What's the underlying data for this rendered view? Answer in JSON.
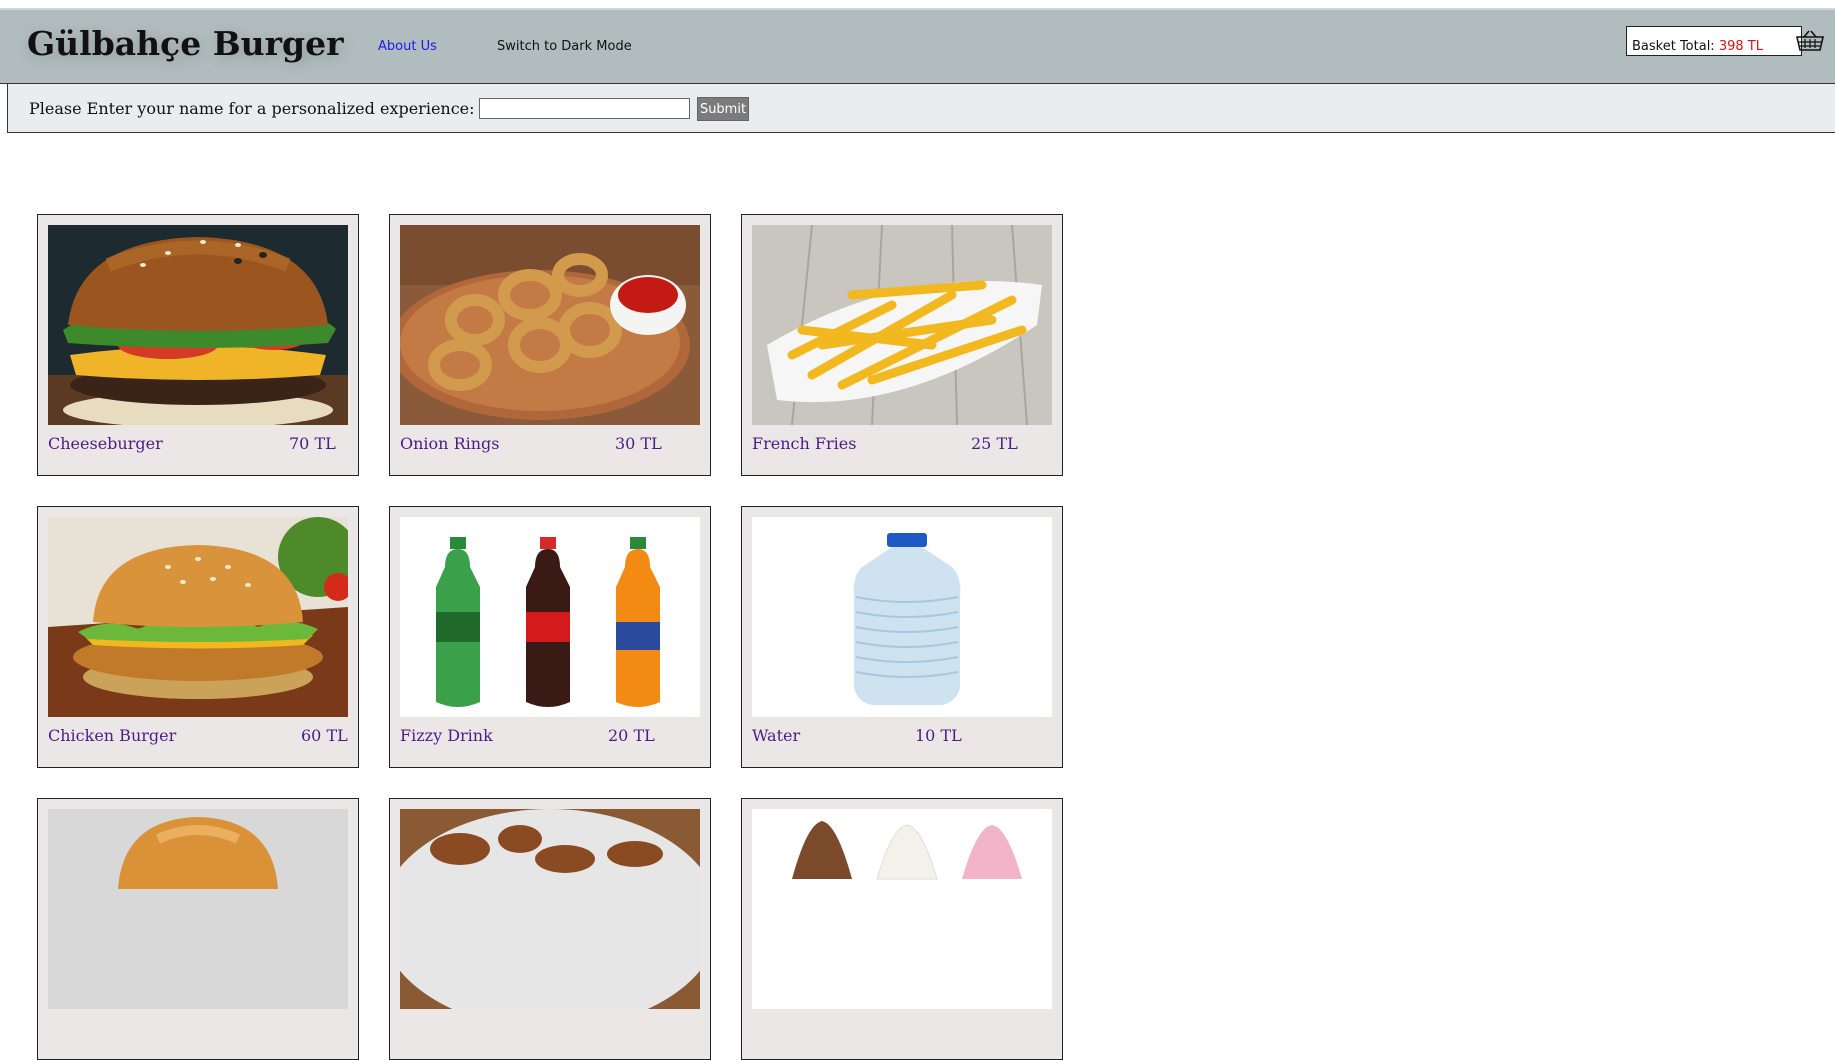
{
  "header": {
    "title": "Gülbahçe Burger",
    "about_label": "About Us",
    "dark_mode_label": "Switch to Dark Mode",
    "basket_label": "Basket Total:",
    "basket_total": "398 TL",
    "basket_icon": "basket-icon"
  },
  "name_prompt": {
    "label": "Please Enter your name for a personalized experience:",
    "input_value": "",
    "submit_label": "Submit"
  },
  "menu": [
    {
      "name": "Cheeseburger",
      "price": "70 TL",
      "image": "cheeseburger-image"
    },
    {
      "name": "Onion Rings",
      "price": "30 TL",
      "image": "onion-rings-image"
    },
    {
      "name": "French Fries",
      "price": "25 TL",
      "image": "french-fries-image"
    },
    {
      "name": "Chicken Burger",
      "price": "60 TL",
      "image": "chicken-burger-image"
    },
    {
      "name": "Fizzy Drink",
      "price": "20 TL",
      "image": "fizzy-drink-image"
    },
    {
      "name": "Water",
      "price": "10 TL",
      "image": "water-bottle-image"
    },
    {
      "name": "",
      "price": "",
      "image": "bun-burger-image"
    },
    {
      "name": "",
      "price": "",
      "image": "chicken-wings-image"
    },
    {
      "name": "",
      "price": "",
      "image": "ice-cream-image"
    }
  ],
  "colors": {
    "header_bg": "#b0bcbd",
    "namebar_bg": "#e9edf0",
    "card_bg": "#ece7e7",
    "item_text": "#4e1a86",
    "basket_total": "#e01010",
    "link": "#1a1aee"
  }
}
